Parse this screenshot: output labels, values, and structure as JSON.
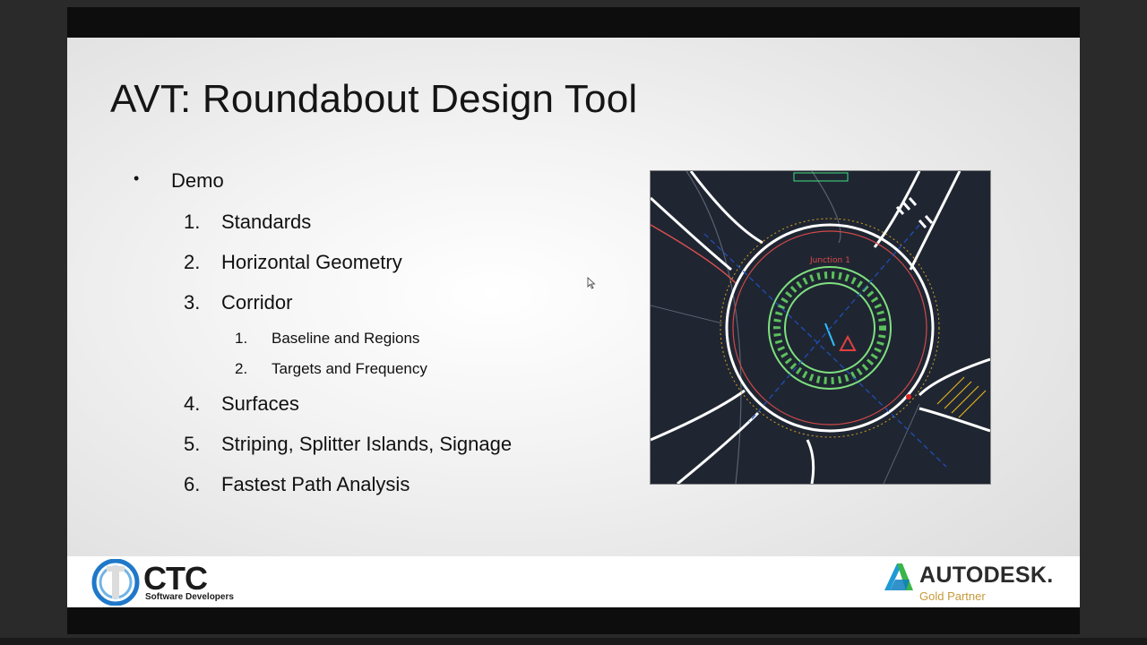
{
  "slide": {
    "title": "AVT: Roundabout Design Tool",
    "bullet": {
      "marker": "•",
      "text": "Demo"
    },
    "items": [
      {
        "num": "1.",
        "text": "Standards"
      },
      {
        "num": "2.",
        "text": "Horizontal Geometry"
      },
      {
        "num": "3.",
        "text": "Corridor"
      },
      {
        "num": "4.",
        "text": "Surfaces"
      },
      {
        "num": "5.",
        "text": "Striping, Splitter Islands, Signage"
      },
      {
        "num": "6.",
        "text": "Fastest Path Analysis"
      }
    ],
    "sub_items": [
      {
        "num": "1.",
        "text": "Baseline and Regions"
      },
      {
        "num": "2.",
        "text": "Targets and Frequency"
      }
    ],
    "image_icon": "roundabout-cad-drawing",
    "image_label": "Junction 1"
  },
  "footer": {
    "ctc_name": "CTC",
    "ctc_sub": "Software Developers",
    "autodesk_name": "AUTODESK.",
    "autodesk_partner": "Gold Partner"
  },
  "colors": {
    "cad_background": "#1f2632",
    "autodesk_gold": "#c79a3a",
    "ctc_blue": "#1f78c8"
  }
}
